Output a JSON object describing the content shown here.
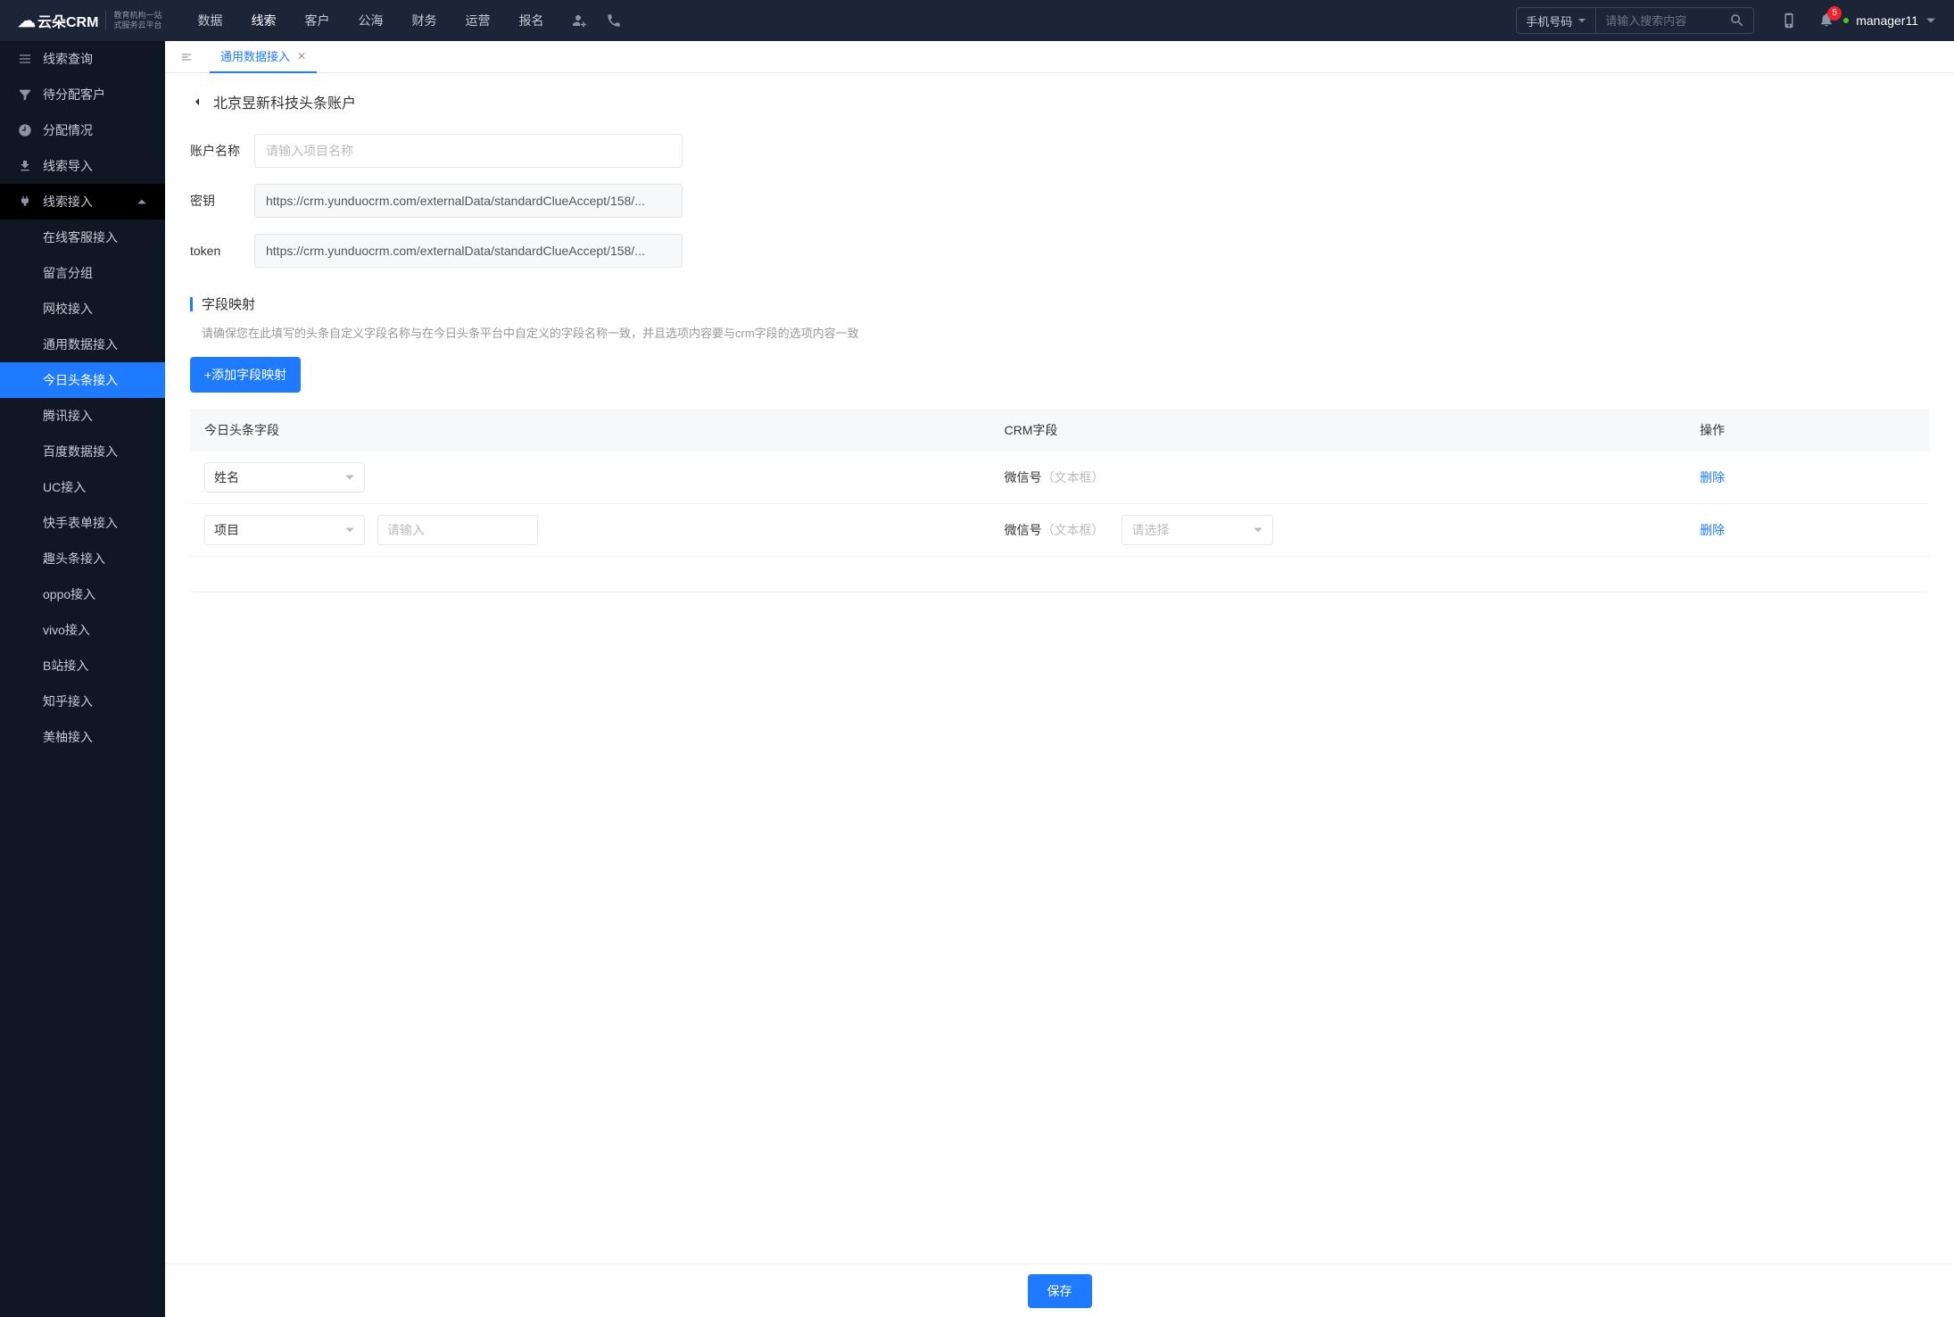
{
  "header": {
    "logo_main": "云朵CRM",
    "logo_sub1": "教育机构一站",
    "logo_sub2": "式服务云平台",
    "nav": [
      "数据",
      "线索",
      "客户",
      "公海",
      "财务",
      "运营",
      "报名"
    ],
    "nav_active_index": 1,
    "search_select": "手机号码",
    "search_placeholder": "请输入搜索内容",
    "badge_count": "5",
    "username": "manager11"
  },
  "sidebar": {
    "items": [
      {
        "label": "线索查询",
        "icon": "list"
      },
      {
        "label": "待分配客户",
        "icon": "filter"
      },
      {
        "label": "分配情况",
        "icon": "clock"
      },
      {
        "label": "线索导入",
        "icon": "export"
      },
      {
        "label": "线索接入",
        "icon": "plug",
        "expanded": true,
        "children": [
          "在线客服接入",
          "留言分组",
          "网校接入",
          "通用数据接入",
          "今日头条接入",
          "腾讯接入",
          "百度数据接入",
          "UC接入",
          "快手表单接入",
          "趣头条接入",
          "oppo接入",
          "vivo接入",
          "B站接入",
          "知乎接入",
          "美柚接入"
        ],
        "active_child_index": 4
      }
    ]
  },
  "tabs": {
    "collapse_hint": "collapse",
    "items": [
      {
        "label": "通用数据接入",
        "closable": true,
        "active": true
      }
    ]
  },
  "page": {
    "back_title": "北京昱新科技头条账户",
    "fields": {
      "name_label": "账户名称",
      "name_placeholder": "请输入项目名称",
      "secret_label": "密钥",
      "secret_value": "https://crm.yunduocrm.com/externalData/standardClueAccept/158/...",
      "token_label": "token",
      "token_value": "https://crm.yunduocrm.com/externalData/standardClueAccept/158/..."
    },
    "section_title": "字段映射",
    "section_desc": "请确保您在此填写的头条自定义字段名称与在今日头条平台中自定义的字段名称一致，并且选项内容要与crm字段的选项内容一致",
    "add_button": "+添加字段映射",
    "table": {
      "headers": [
        "今日头条字段",
        "CRM字段",
        "操作"
      ],
      "rows": [
        {
          "field_select": "姓名",
          "field_input": null,
          "crm_label": "微信号",
          "crm_hint": "（文本框）",
          "crm_select": null,
          "action": "删除"
        },
        {
          "field_select": "项目",
          "field_input_placeholder": "请输入",
          "crm_label": "微信号",
          "crm_hint": "（文本框）",
          "crm_select_placeholder": "请选择",
          "action": "删除"
        }
      ]
    },
    "save_button": "保存"
  }
}
